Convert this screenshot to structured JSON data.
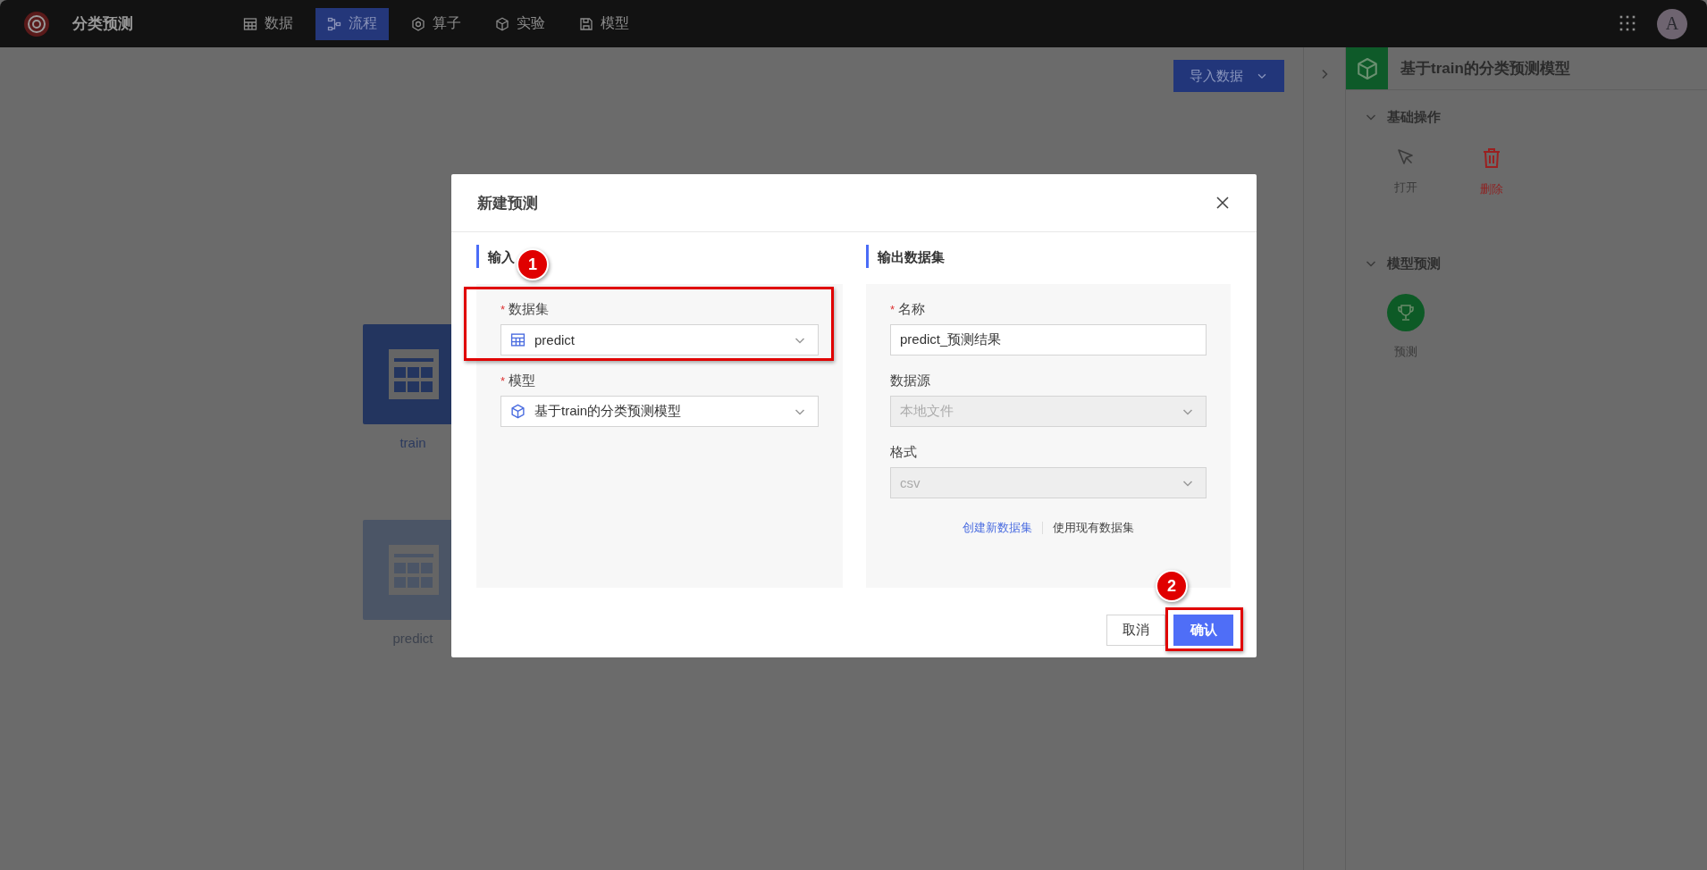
{
  "app": {
    "title": "分类预测"
  },
  "nav": [
    {
      "label": "数据",
      "selected": false
    },
    {
      "label": "流程",
      "selected": true
    },
    {
      "label": "算子",
      "selected": false
    },
    {
      "label": "实验",
      "selected": false
    },
    {
      "label": "模型",
      "selected": false
    }
  ],
  "user": {
    "avatar_letter": "A"
  },
  "canvas": {
    "import_button": "导入数据",
    "nodes": [
      {
        "label": "train",
        "selected": true
      },
      {
        "label": "predict",
        "selected": false
      }
    ]
  },
  "side_panel": {
    "title": "基于train的分类预测模型",
    "sections": [
      {
        "title": "基础操作",
        "expanded": true,
        "actions": [
          {
            "label": "打开",
            "kind": "open"
          },
          {
            "label": "删除",
            "kind": "delete"
          }
        ]
      },
      {
        "title": "模型预测",
        "expanded": true,
        "actions": [
          {
            "label": "预测",
            "kind": "predict"
          }
        ]
      }
    ]
  },
  "dialog": {
    "title": "新建预测",
    "input": {
      "heading": "输入",
      "fields": [
        {
          "label": "数据集",
          "required_mark": "*",
          "value": "predict",
          "disabled": false
        },
        {
          "label": "模型",
          "required_mark": "*",
          "value": "基于train的分类预测模型",
          "disabled": false
        }
      ]
    },
    "output": {
      "heading": "输出数据集",
      "fields": [
        {
          "label": "名称",
          "required_mark": "*",
          "kind": "text",
          "value": "predict_预测结果",
          "disabled": false
        },
        {
          "label": "数据源",
          "kind": "select",
          "value": "本地文件",
          "disabled": true
        },
        {
          "label": "格式",
          "kind": "select",
          "value": "csv",
          "disabled": true
        }
      ],
      "links": [
        {
          "label": "创建新数据集",
          "selected": true
        },
        {
          "label": "使用现有数据集",
          "selected": false
        }
      ]
    },
    "buttons": [
      {
        "label": "取消",
        "kind": "default"
      },
      {
        "label": "确认",
        "kind": "primary"
      }
    ]
  },
  "annotations": [
    {
      "number": "1"
    },
    {
      "number": "2"
    }
  ]
}
